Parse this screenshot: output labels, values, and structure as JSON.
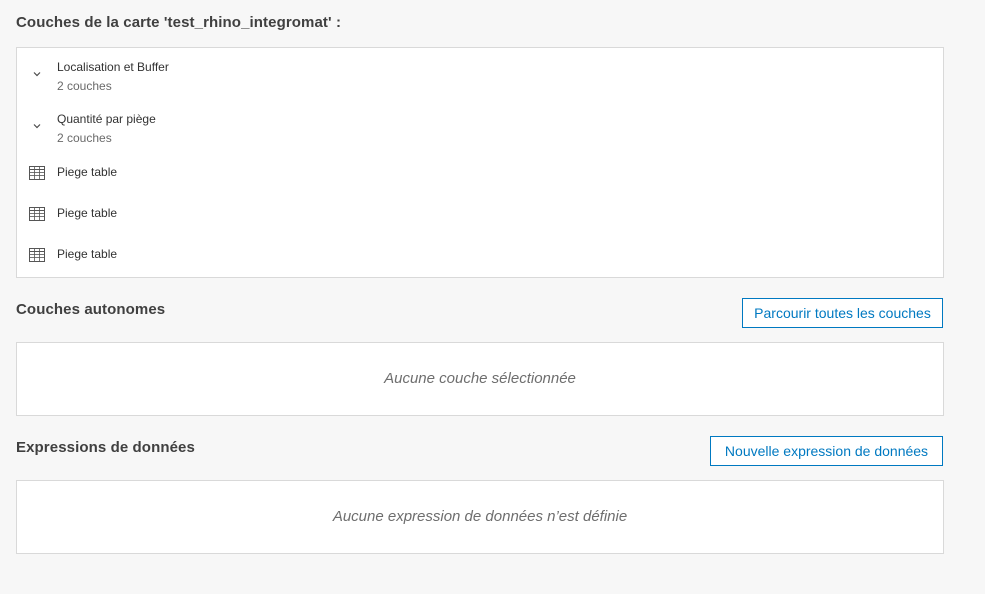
{
  "map_layers": {
    "title": "Couches de la carte 'test_rhino_integromat' :",
    "items": [
      {
        "type": "group",
        "label": "Localisation et Buffer",
        "sub": "2 couches",
        "icon": "chevron-down-icon"
      },
      {
        "type": "group",
        "label": "Quantité par piège",
        "sub": "2 couches",
        "icon": "chevron-down-icon"
      },
      {
        "type": "table",
        "label": "Piege table",
        "icon": "table-icon"
      },
      {
        "type": "table",
        "label": "Piege table",
        "icon": "table-icon"
      },
      {
        "type": "table",
        "label": "Piege table",
        "icon": "table-icon"
      }
    ]
  },
  "standalone_layers": {
    "title": "Couches autonomes",
    "browse_button": "Parcourir toutes les couches",
    "empty_message": "Aucune couche sélectionnée"
  },
  "data_expressions": {
    "title": "Expressions de données",
    "new_button": "Nouvelle expression de données",
    "empty_message": "Aucune expression de données n’est définie"
  },
  "colors": {
    "accent": "#0079c1",
    "border": "#d9d9d9",
    "background": "#f7f7f7"
  }
}
